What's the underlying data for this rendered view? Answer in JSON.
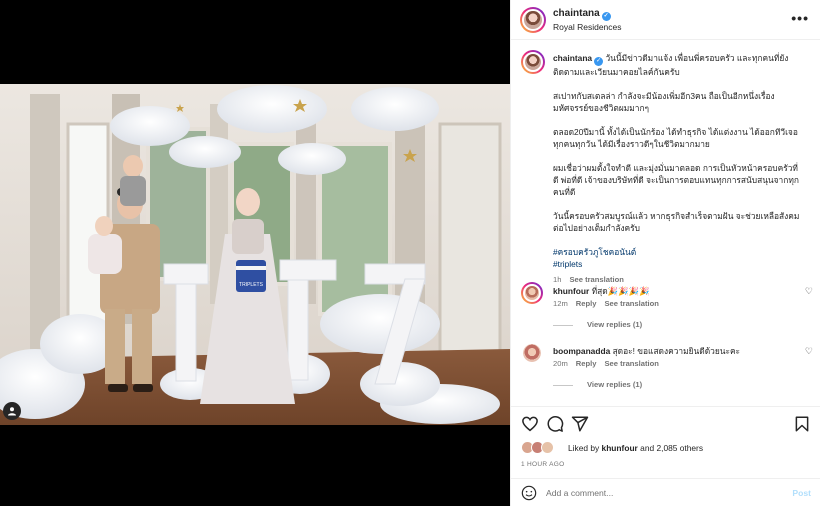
{
  "post": {
    "username": "chaintana",
    "location": "Royal Residences",
    "more_label": "•••",
    "photo_label": "TRIPLETS"
  },
  "caption": {
    "username": "chaintana",
    "lines": [
      "วันนี้มีข่าวดีมาแจ้ง เพื่อนพี่ครอบครัว และทุกคนที่ยังติดตามและเวียนมาคอยไลค์กันครับ",
      "สเปาทกับสเตลล่า กำลังจะมีน้องเพิ่มอีก3คน ถือเป็นอีกหนึ่งเรื่องมหัศจรรย์ของชีวิตผมมากๆ",
      "ตลอด20ปีมานี้ ทั้งได้เป็นนักร้อง ได้ทำธุรกิจ ได้แต่งงาน ได้ออกทีวีเจอทุกคนทุกวัน ได้มีเรื่องราวดีๆในชีวิตมากมาย",
      "ผมเชื่อว่าผมตั้งใจทำดี และมุ่งมั่นมาตลอด การเป็นหัวหน้าครอบครัวที่ดี พ่อที่ดี เจ้าของบริษัทที่ดี จะเป็นการตอบแทนทุกการสนับสนุนจากทุกคนที่ดี",
      "วันนี้ครอบครัวสมบูรณ์แล้ว หากธุรกิจสำเร็จตามฝัน จะช่วยเหลือสังคมต่อไปอย่างเต็มกำลังครับ"
    ],
    "hashtags": [
      "#ครอบครัวภูโชคอนันต์",
      "#triplets"
    ],
    "time": "1h",
    "see_translation": "See translation"
  },
  "comments": [
    {
      "username": "khunfour",
      "text": "ที่สุด🎉🎉🎉🎉",
      "time": "12m",
      "reply": "Reply",
      "see_translation": "See translation",
      "view_replies": "View replies (1)"
    },
    {
      "username": "boompanadda",
      "text": "สุดอะ! ขอแสดงความยินดีด้วยนะคะ",
      "time": "20m",
      "reply": "Reply",
      "see_translation": "See translation",
      "view_replies": "View replies (1)"
    }
  ],
  "likes": {
    "prefix": "Liked by",
    "user": "khunfour",
    "suffix": "and 2,085 others"
  },
  "timestamp": "1 HOUR AGO",
  "add_comment": {
    "placeholder": "Add a comment...",
    "post_label": "Post"
  },
  "colors": {
    "verified": "#3897f0",
    "link": "#00376b",
    "post_disabled": "#b2dffc",
    "meta": "#737373"
  }
}
